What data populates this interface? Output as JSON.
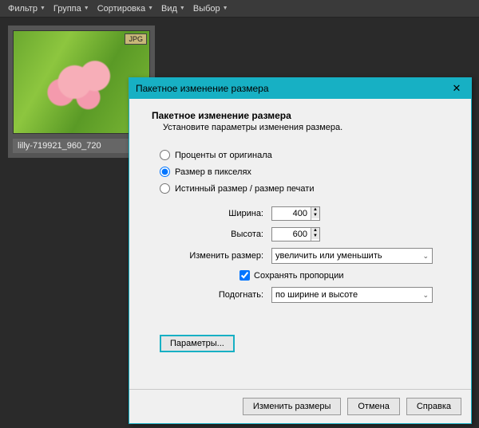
{
  "menubar": {
    "items": [
      "Фильтр",
      "Группа",
      "Сортировка",
      "Вид",
      "Выбор"
    ]
  },
  "thumbnail": {
    "badge": "JPG",
    "caption": "lilly-719921_960_720"
  },
  "dialog": {
    "title": "Пакетное изменение размера",
    "header": {
      "bold": "Пакетное изменение размера",
      "sub": "Установите параметры изменения размера."
    },
    "radios": {
      "percent": "Проценты от оригинала",
      "pixels": "Размер в пикселях",
      "actual": "Истинный размер / размер печати",
      "selected": "pixels"
    },
    "fields": {
      "width_label": "Ширина:",
      "width_value": "400",
      "height_label": "Высота:",
      "height_value": "600",
      "resize_label": "Изменить размер:",
      "resize_value": "увеличить или уменьшить",
      "keep_proportions": "Сохранять пропорции",
      "fit_label": "Подогнать:",
      "fit_value": "по ширине и высоте"
    },
    "params_button": "Параметры...",
    "footer": {
      "apply": "Изменить размеры",
      "cancel": "Отмена",
      "help": "Справка"
    }
  }
}
